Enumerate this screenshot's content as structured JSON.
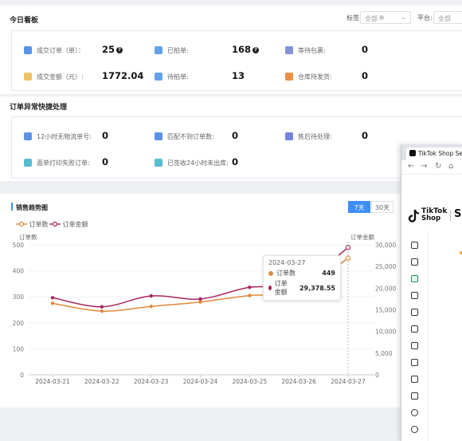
{
  "today": {
    "title": "今日看板",
    "filters": {
      "tag_label": "标签:",
      "tag_value": "全部",
      "platform_label": "平台:",
      "platform_value": "全部"
    },
    "stats": [
      {
        "label": "成交订单（单）：",
        "value": "25",
        "help": true,
        "icon_color": "#3f7fe0"
      },
      {
        "label": "已拍单:",
        "value": "168",
        "help": true,
        "icon_color": "#4a90e2"
      },
      {
        "label": "等待包裹:",
        "value": "0",
        "help": false,
        "icon_color": "#6d7fcc"
      },
      {
        "label": "成交金额（元）:",
        "value": "1772.04",
        "help": false,
        "icon_color": "#e9b949"
      },
      {
        "label": "待拍单:",
        "value": "13",
        "help": false,
        "icon_color": "#4a90e2"
      },
      {
        "label": "仓库待发货:",
        "value": "0",
        "help": false,
        "icon_color": "#e67e22"
      }
    ]
  },
  "exceptions": {
    "title": "订单异常快捷处理",
    "stats": [
      {
        "label": "12小时无物流单号:",
        "value": "0",
        "icon_color": "#3f7fe0"
      },
      {
        "label": "匹配不到订单数:",
        "value": "0",
        "icon_color": "#3f7fe0"
      },
      {
        "label": "售后待处理:",
        "value": "0",
        "icon_color": "#5a6fd6"
      },
      {
        "label": "面单打印失败订单:",
        "value": "0",
        "icon_color": "#38b2c9"
      },
      {
        "label": "已签收24小时未出库:",
        "value": "0",
        "icon_color": "#38b2c9"
      }
    ]
  },
  "trend": {
    "title": "销售趋势图",
    "range_buttons": [
      "7天",
      "30天"
    ],
    "active_range": "7天"
  },
  "chart_data": {
    "type": "line",
    "x": [
      "2024-03-21",
      "2024-03-22",
      "2024-03-23",
      "2024-03-24",
      "2024-03-25",
      "2024-03-26",
      "2024-03-27"
    ],
    "series": [
      {
        "name": "订单数",
        "axis": "left",
        "color": "#e08a3c",
        "values": [
          275,
          245,
          263,
          280,
          305,
          320,
          449
        ]
      },
      {
        "name": "订单金额",
        "axis": "right",
        "color": "#a8275e",
        "values": [
          17800,
          15700,
          18200,
          17500,
          20200,
          21000,
          29378.55
        ]
      }
    ],
    "yleft": {
      "label": "订单数",
      "ticks": [
        0,
        100,
        200,
        300,
        400,
        500
      ],
      "lim": [
        0,
        500
      ]
    },
    "yright": {
      "label": "订单金额",
      "ticks": [
        0,
        5000,
        10000,
        15000,
        20000,
        25000,
        30000
      ],
      "lim": [
        0,
        30000
      ]
    },
    "legend": "top-left",
    "tooltip": {
      "title": "2024-03-27",
      "rows": [
        {
          "name": "订单数",
          "value": "449",
          "color": "#e08a3c"
        },
        {
          "name": "订单金额",
          "value": "29,378.55",
          "color": "#a8275e"
        }
      ]
    }
  },
  "tiktok_window": {
    "tab_title": "TikTok Shop Seller",
    "logo_text_1": "TikTok",
    "logo_text_2": "Shop",
    "logo_suffix": "S"
  }
}
